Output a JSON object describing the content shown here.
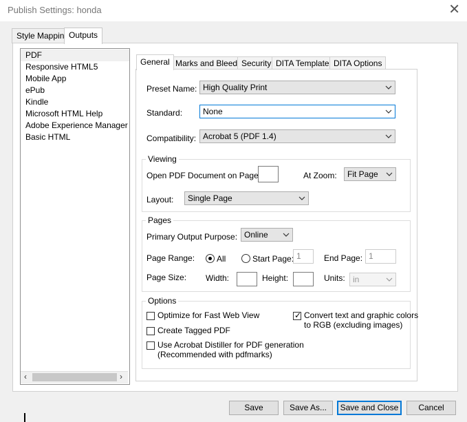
{
  "window": {
    "title": "Publish Settings: honda",
    "close_glyph": "✕"
  },
  "outer_tabs": [
    {
      "label": "Style Mapping"
    },
    {
      "label": "Outputs"
    }
  ],
  "outputs_list": {
    "items": [
      "PDF",
      "Responsive HTML5",
      "Mobile App",
      "ePub",
      "Kindle",
      "Microsoft HTML Help",
      "Adobe Experience Manager Mo",
      "Basic HTML"
    ],
    "selected": "PDF",
    "scroll_left_glyph": "‹",
    "scroll_right_glyph": "›"
  },
  "inner_tabs": [
    {
      "label": "General"
    },
    {
      "label": "Marks and Bleeds"
    },
    {
      "label": "Security"
    },
    {
      "label": "DITA Template"
    },
    {
      "label": "DITA Options"
    }
  ],
  "general": {
    "preset_label": "Preset Name:",
    "preset_value": "High Quality Print",
    "standard_label": "Standard:",
    "standard_value": "None",
    "compat_label": "Compatibility:",
    "compat_value": "Acrobat 5 (PDF 1.4)"
  },
  "viewing": {
    "title": "Viewing",
    "open_page_label": "Open PDF Document on Page:",
    "open_page_value": "",
    "zoom_label": "At Zoom:",
    "zoom_value": "Fit Page",
    "layout_label": "Layout:",
    "layout_value": "Single Page"
  },
  "pages": {
    "title": "Pages",
    "purpose_label": "Primary Output Purpose:",
    "purpose_value": "Online",
    "range_label": "Page Range:",
    "all_label": "All",
    "start_label": "Start Page:",
    "start_value": "1",
    "end_label": "End Page:",
    "end_value": "1",
    "size_label": "Page Size:",
    "width_label": "Width:",
    "height_label": "Height:",
    "units_label": "Units:",
    "units_value": "in"
  },
  "options": {
    "title": "Options",
    "fast_web": {
      "label": "Optimize for Fast Web View",
      "checked": false
    },
    "tagged": {
      "label": "Create Tagged PDF",
      "checked": false
    },
    "distiller": {
      "label": "Use Acrobat Distiller for PDF generation",
      "label2": "(Recommended with pdfmarks)",
      "checked": false
    },
    "convert_rgb": {
      "label": "Convert text and graphic colors",
      "label2": "to RGB (excluding images)",
      "checked": true,
      "glyph": "✓"
    }
  },
  "buttons": {
    "save": "Save",
    "save_as": "Save As...",
    "save_close": "Save and Close",
    "cancel": "Cancel"
  },
  "colors": {
    "accent": "#0078d7",
    "window_bg": "#f0f0f0",
    "panel_bg": "#ffffff"
  }
}
